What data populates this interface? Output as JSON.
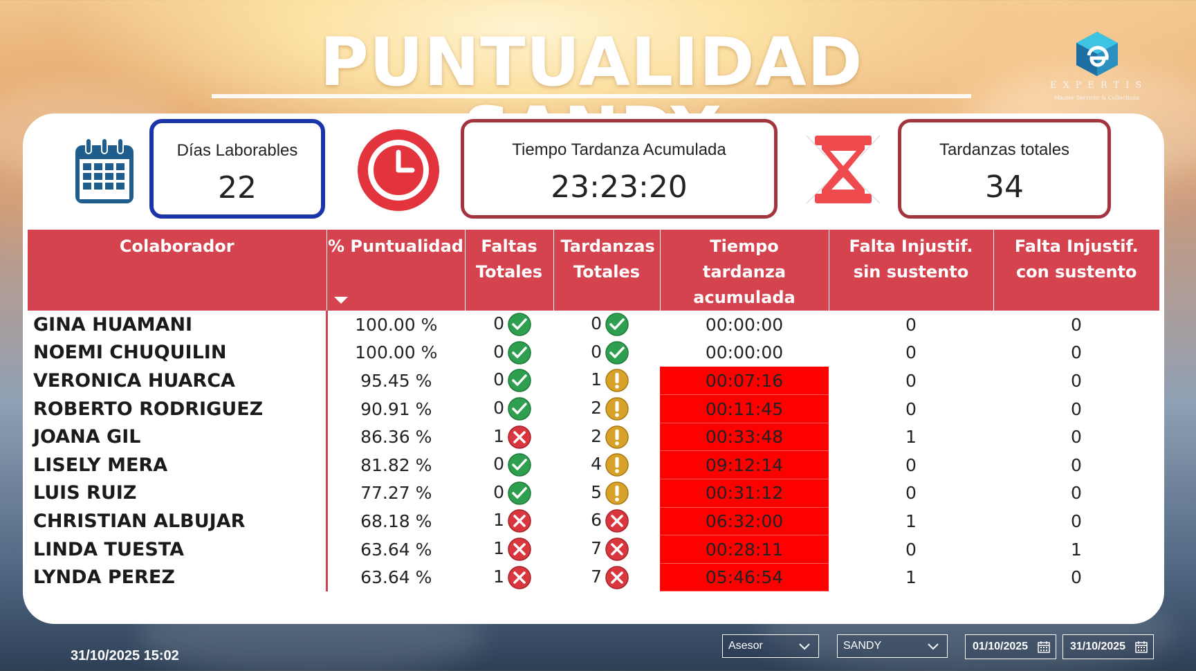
{
  "header": {
    "title": "PUNTUALIDAD SANDY"
  },
  "logo": {
    "brand": "EXPERTIS",
    "tagline": "Master Servicer & Collections"
  },
  "kpis": {
    "dias": {
      "label": "Días Laborables",
      "value": "22",
      "icon": "calendar-icon"
    },
    "tiempo": {
      "label": "Tiempo Tardanza Acumulada",
      "value": "23:23:20",
      "icon": "clock-icon"
    },
    "tardanzas": {
      "label": "Tardanzas totales",
      "value": "34",
      "icon": "hourglass-icon"
    }
  },
  "table": {
    "columns": [
      "Colaborador",
      "% Puntualidad",
      "Faltas Totales",
      "Tardanzas Totales",
      "Tiempo tardanza acumulada",
      "Falta Injustif. sin sustento",
      "Falta Injustif. con sustento"
    ],
    "rows": [
      {
        "name": "GINA HUAMANI",
        "puntualidad": "100.00 %",
        "faltas": "0",
        "faltas_status": "ok",
        "tardanzas": "0",
        "tardanzas_status": "ok",
        "tiempo": "00:00:00",
        "late": false,
        "sin": "0",
        "con": "0"
      },
      {
        "name": "NOEMI CHUQUILIN",
        "puntualidad": "100.00 %",
        "faltas": "0",
        "faltas_status": "ok",
        "tardanzas": "0",
        "tardanzas_status": "ok",
        "tiempo": "00:00:00",
        "late": false,
        "sin": "0",
        "con": "0"
      },
      {
        "name": "VERONICA HUARCA",
        "puntualidad": "95.45 %",
        "faltas": "0",
        "faltas_status": "ok",
        "tardanzas": "1",
        "tardanzas_status": "warn",
        "tiempo": "00:07:16",
        "late": true,
        "sin": "0",
        "con": "0"
      },
      {
        "name": "ROBERTO RODRIGUEZ",
        "puntualidad": "90.91 %",
        "faltas": "0",
        "faltas_status": "ok",
        "tardanzas": "2",
        "tardanzas_status": "warn",
        "tiempo": "00:11:45",
        "late": true,
        "sin": "0",
        "con": "0"
      },
      {
        "name": "JOANA GIL",
        "puntualidad": "86.36 %",
        "faltas": "1",
        "faltas_status": "bad",
        "tardanzas": "2",
        "tardanzas_status": "warn",
        "tiempo": "00:33:48",
        "late": true,
        "sin": "1",
        "con": "0"
      },
      {
        "name": "LISELY MERA",
        "puntualidad": "81.82 %",
        "faltas": "0",
        "faltas_status": "ok",
        "tardanzas": "4",
        "tardanzas_status": "warn",
        "tiempo": "09:12:14",
        "late": true,
        "sin": "0",
        "con": "0"
      },
      {
        "name": "LUIS RUIZ",
        "puntualidad": "77.27 %",
        "faltas": "0",
        "faltas_status": "ok",
        "tardanzas": "5",
        "tardanzas_status": "warn",
        "tiempo": "00:31:12",
        "late": true,
        "sin": "0",
        "con": "0"
      },
      {
        "name": "CHRISTIAN ALBUJAR",
        "puntualidad": "68.18 %",
        "faltas": "1",
        "faltas_status": "bad",
        "tardanzas": "6",
        "tardanzas_status": "bad",
        "tiempo": "06:32:00",
        "late": true,
        "sin": "1",
        "con": "0"
      },
      {
        "name": "LINDA TUESTA",
        "puntualidad": "63.64 %",
        "faltas": "1",
        "faltas_status": "bad",
        "tardanzas": "7",
        "tardanzas_status": "bad",
        "tiempo": "00:28:11",
        "late": true,
        "sin": "0",
        "con": "1"
      },
      {
        "name": "LYNDA PEREZ",
        "puntualidad": "63.64 %",
        "faltas": "1",
        "faltas_status": "bad",
        "tardanzas": "7",
        "tardanzas_status": "bad",
        "tiempo": "05:46:54",
        "late": true,
        "sin": "1",
        "con": "0"
      }
    ]
  },
  "footer": {
    "timestamp": "31/10/2025 15:02",
    "filter_asesor": "Asesor",
    "filter_value": "SANDY",
    "date_from": "01/10/2025",
    "date_to": "31/10/2025"
  },
  "colors": {
    "header_red": "#d5434f",
    "late_red": "#ff0000",
    "ok_green": "#2e9e4f",
    "warn_amber": "#d7a12a",
    "bad_red": "#d9363e",
    "blue_border": "#1a35a8",
    "maroon_border": "#a3353f"
  }
}
